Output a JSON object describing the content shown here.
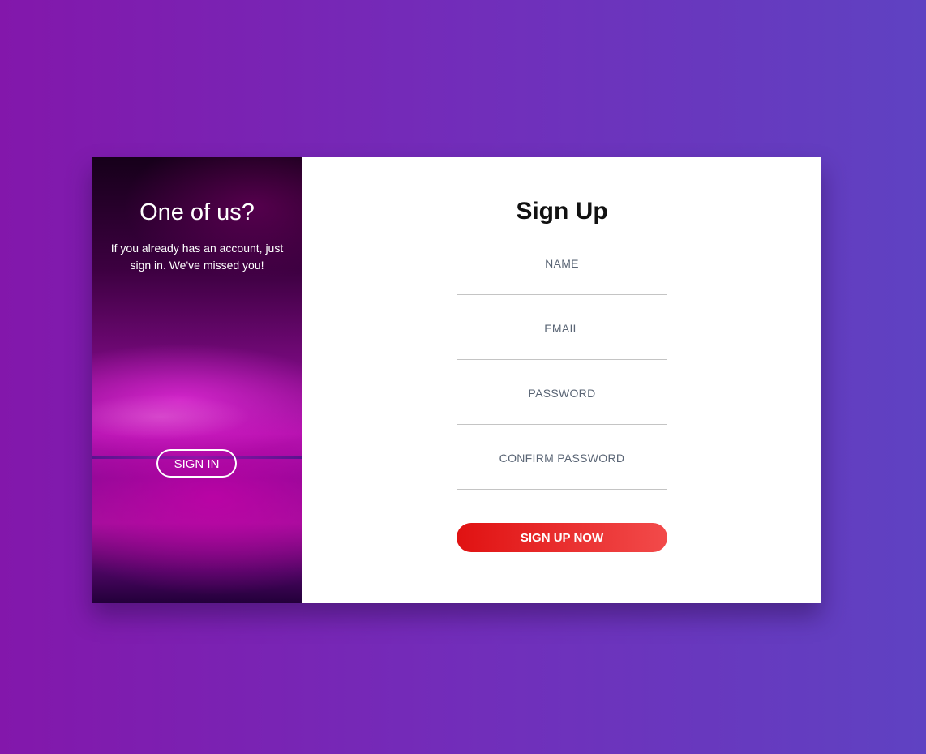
{
  "left_panel": {
    "title": "One of us?",
    "text": "If you already has an account, just sign in. We've missed you!",
    "signin_label": "SIGN IN"
  },
  "form": {
    "title": "Sign Up",
    "fields": [
      {
        "label": "NAME"
      },
      {
        "label": "EMAIL"
      },
      {
        "label": "PASSWORD"
      },
      {
        "label": "CONFIRM PASSWORD"
      }
    ],
    "submit_label": "SIGN UP NOW"
  },
  "colors": {
    "background_start": "#8317ab",
    "background_end": "#5f42c2",
    "button_start": "#e01212",
    "button_end": "#f24a4a"
  }
}
